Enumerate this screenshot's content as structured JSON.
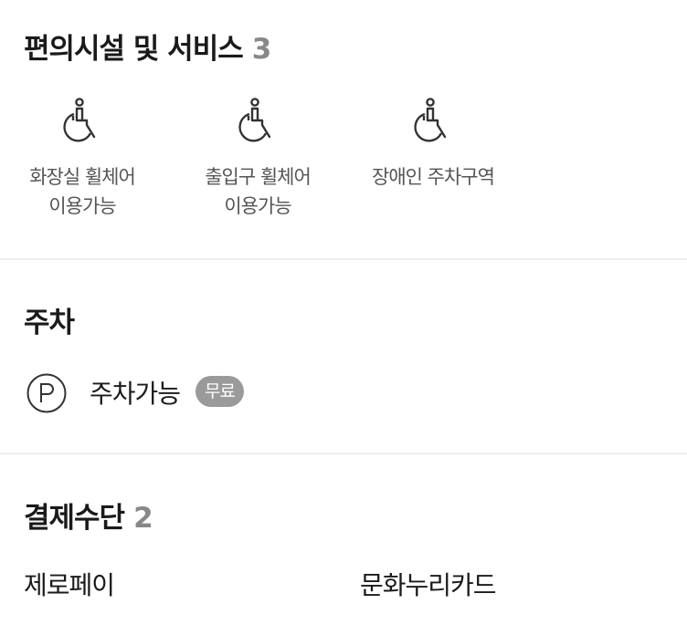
{
  "facilities": {
    "title": "편의시설 및 서비스",
    "count": "3",
    "items": [
      {
        "icon": "wheelchair-icon",
        "line1": "화장실 휠체어",
        "line2": "이용가능"
      },
      {
        "icon": "wheelchair-icon",
        "line1": "출입구 휠체어",
        "line2": "이용가능"
      },
      {
        "icon": "wheelchair-icon",
        "line1": "장애인 주차구역",
        "line2": ""
      }
    ]
  },
  "parking": {
    "title": "주차",
    "icon": "parking-icon",
    "label": "주차가능",
    "badge": "무료"
  },
  "payment": {
    "title": "결제수단",
    "count": "2",
    "methods": [
      "제로페이",
      "문화누리카드"
    ]
  }
}
